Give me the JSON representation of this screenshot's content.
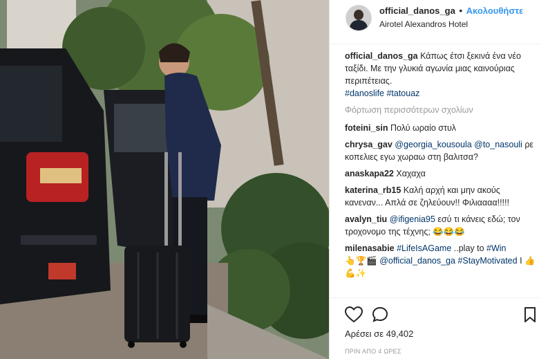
{
  "header": {
    "username": "official_danos_ga",
    "separator": "•",
    "follow_label": "Ακολουθήστε",
    "location": "Airotel Alexandros Hotel"
  },
  "caption": {
    "username": "official_danos_ga",
    "text": "Κάπως έτσι ξεκινά ένα νέο ταξίδι. Με την γλυκιά αγωνία μιας καινούριας περιπέτειας.",
    "hashtags": "#danoslife #tatouaz"
  },
  "load_more": "Φόρτωση περισσότερων σχολίων",
  "comments": [
    {
      "user": "foteini_sin",
      "mention": "",
      "text": "Πολύ ωραίο στυλ"
    },
    {
      "user": "chrysa_gav",
      "mention": "@georgia_kousoula @to_nasouli",
      "text": "ρε κοπελιες εγω χωραω στη βαλιτσα?"
    },
    {
      "user": "anaskapa22",
      "mention": "",
      "text": "Χαχαχα"
    },
    {
      "user": "katerina_rb15",
      "mention": "",
      "text": "Καλή αρχή και μην ακούς κανεναν... Απλά σε ζηλεύουν!! Φιλιαααα!!!!!"
    },
    {
      "user": "avalyn_tiu",
      "mention": "@ifigenia95",
      "text": "εσύ τι κάνεις εδώ; τον τροχονομο της τέχνης; 😂😂😂"
    },
    {
      "user": "milenasabie",
      "mention": "#LifeIsAGame",
      "text": "..play to",
      "mention2": "#Win",
      "emoji": "👆🏆🎬",
      "mention3": "@official_danos_ga #StayMotivated",
      "tail": "I 👍💪✨"
    }
  ],
  "footer": {
    "likes": "Αρέσει σε 49,402",
    "time": "ΠΡΙΝ ΑΠΟ 4 ΩΡΕΣ"
  },
  "icons": {
    "like": "heart-icon",
    "comment": "comment-icon",
    "save": "bookmark-icon"
  },
  "colors": {
    "link": "#003569",
    "follow": "#3897f0",
    "muted": "#999999"
  }
}
